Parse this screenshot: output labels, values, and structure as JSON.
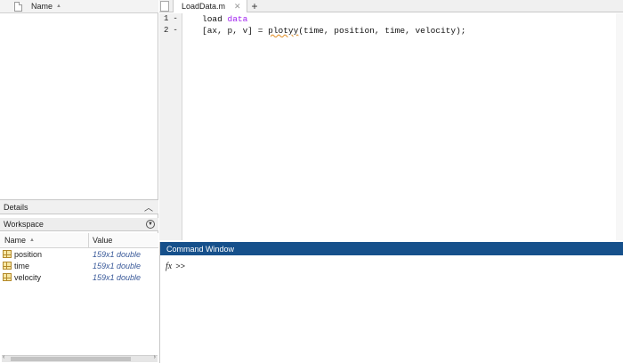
{
  "current_folder": {
    "column_name": "Name"
  },
  "details": {
    "label": "Details"
  },
  "workspace": {
    "label": "Workspace",
    "columns": [
      "Name",
      "Value"
    ],
    "variables": [
      {
        "name": "position",
        "value": "159x1 double"
      },
      {
        "name": "time",
        "value": "159x1 double"
      },
      {
        "name": "velocity",
        "value": "159x1 double"
      }
    ]
  },
  "editor": {
    "tab_label": "LoadData.m",
    "line_numbers": [
      "1",
      "2"
    ],
    "line_marker": "-",
    "lines": [
      {
        "a": "load ",
        "b": "data",
        "c": ""
      },
      {
        "a": "[ax, p, v] = ",
        "b": "plotyy",
        "c": "(time, position, time, velocity);"
      }
    ]
  },
  "command_window": {
    "title": "Command Window",
    "fx": "fx",
    "prompt": ">>"
  },
  "icons": {
    "file": "file-icon",
    "sort": "sort-ascending-icon",
    "collapse": "chevron-up-icon",
    "actions": "actions-menu-icon",
    "variable": "matrix-variable-icon",
    "close_tab": "close-icon",
    "new_tab": "plus-icon"
  }
}
